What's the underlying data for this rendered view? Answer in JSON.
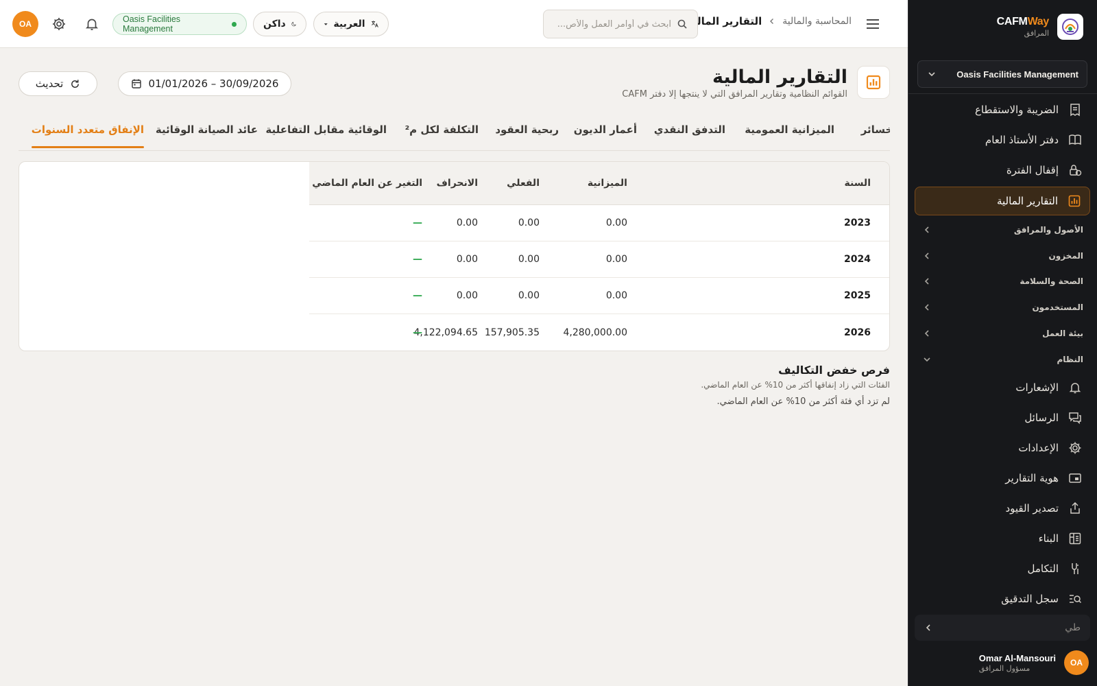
{
  "brand": {
    "name_a": "CAFM",
    "name_b": "Way",
    "subtitle": "المرافق"
  },
  "sidebar": {
    "org_selector": "Oasis Facilities Management",
    "items_top": [
      {
        "label": "الضريبة والاستقطاع",
        "icon": "receipt-icon"
      },
      {
        "label": "دفتر الأستاذ العام",
        "icon": "book-icon"
      },
      {
        "label": "إقفال الفترة",
        "icon": "lock-clock-icon"
      },
      {
        "label": "التقارير المالية",
        "icon": "chart-icon",
        "active": true
      }
    ],
    "groups": [
      {
        "label": "الأصول والمرافق",
        "expanded": false
      },
      {
        "label": "المخزون",
        "expanded": false
      },
      {
        "label": "الصحة والسلامة",
        "expanded": false
      },
      {
        "label": "المستخدمون",
        "expanded": false
      },
      {
        "label": "بيئة العمل",
        "expanded": false
      },
      {
        "label": "النظام",
        "expanded": true
      }
    ],
    "items_system": [
      {
        "label": "الإشعارات",
        "icon": "bell-icon"
      },
      {
        "label": "الرسائل",
        "icon": "messages-icon"
      },
      {
        "label": "الإعدادات",
        "icon": "gear-icon"
      },
      {
        "label": "هوية التقارير",
        "icon": "branding-icon"
      },
      {
        "label": "تصدير القيود",
        "icon": "export-icon"
      },
      {
        "label": "البناء",
        "icon": "building-icon"
      },
      {
        "label": "التكامل",
        "icon": "integration-icon"
      },
      {
        "label": "سجل التدقيق",
        "icon": "audit-search-icon"
      }
    ],
    "collapse_label": "طي",
    "user": {
      "initials": "OA",
      "name": "Omar Al-Mansouri",
      "role": "مسؤول المرافق"
    }
  },
  "topbar": {
    "breadcrumb_parent": "المحاسبة والمالية",
    "breadcrumb_current": "التقارير المالية",
    "search_placeholder": "ابحث في أوامر العمل والأص...",
    "language_label": "العربية",
    "theme_label": "داكن",
    "org_badge": "Oasis Facilities Management",
    "avatar_initials": "OA"
  },
  "page": {
    "title": "التقارير المالية",
    "subtitle": "القوائم النظامية وتقارير المرافق التي لا ينتجها إلا دفتر CAFM",
    "date_range": "01/01/2026 – 30/09/2026",
    "refresh_label": "تحديث"
  },
  "tabs": [
    {
      "label": "لخسائر"
    },
    {
      "label": "الميزانية العمومية"
    },
    {
      "label": "التدفق النقدي"
    },
    {
      "label": "أعمار الديون"
    },
    {
      "label": "ربحية العقود"
    },
    {
      "label": "التكلفة لكل م²"
    },
    {
      "label": "الوقائية مقابل التفاعلية"
    },
    {
      "label": "عائد الصيانة الوقائية"
    },
    {
      "label": "الإنفاق متعدد السنوات",
      "active": true
    }
  ],
  "table": {
    "headers": {
      "year": "السنة",
      "budget": "الميزانية",
      "actual": "الفعلي",
      "variance": "الانحراف",
      "change": "التغير عن العام الماضي"
    },
    "rows": [
      {
        "year": "2023",
        "budget": "0.00",
        "actual": "0.00",
        "variance": "0.00",
        "change": "—"
      },
      {
        "year": "2024",
        "budget": "0.00",
        "actual": "0.00",
        "variance": "0.00",
        "change": "—"
      },
      {
        "year": "2025",
        "budget": "0.00",
        "actual": "0.00",
        "variance": "0.00",
        "change": "—"
      },
      {
        "year": "2026",
        "budget": "4,280,000.00",
        "actual": "157,905.35",
        "variance": "4,122,094.65",
        "change": "—"
      }
    ]
  },
  "savings": {
    "title": "فرص خفض التكاليف",
    "subtitle": "الفئات التي زاد إنفاقها أكثر من 10% عن العام الماضي.",
    "empty": "لم تزد أي فئة أكثر من 10% عن العام الماضي."
  },
  "colors": {
    "accent": "#f08a1c",
    "sidebar_bg": "#17181b",
    "page_bg": "#f3f1ee",
    "positive": "#2fa84f"
  }
}
